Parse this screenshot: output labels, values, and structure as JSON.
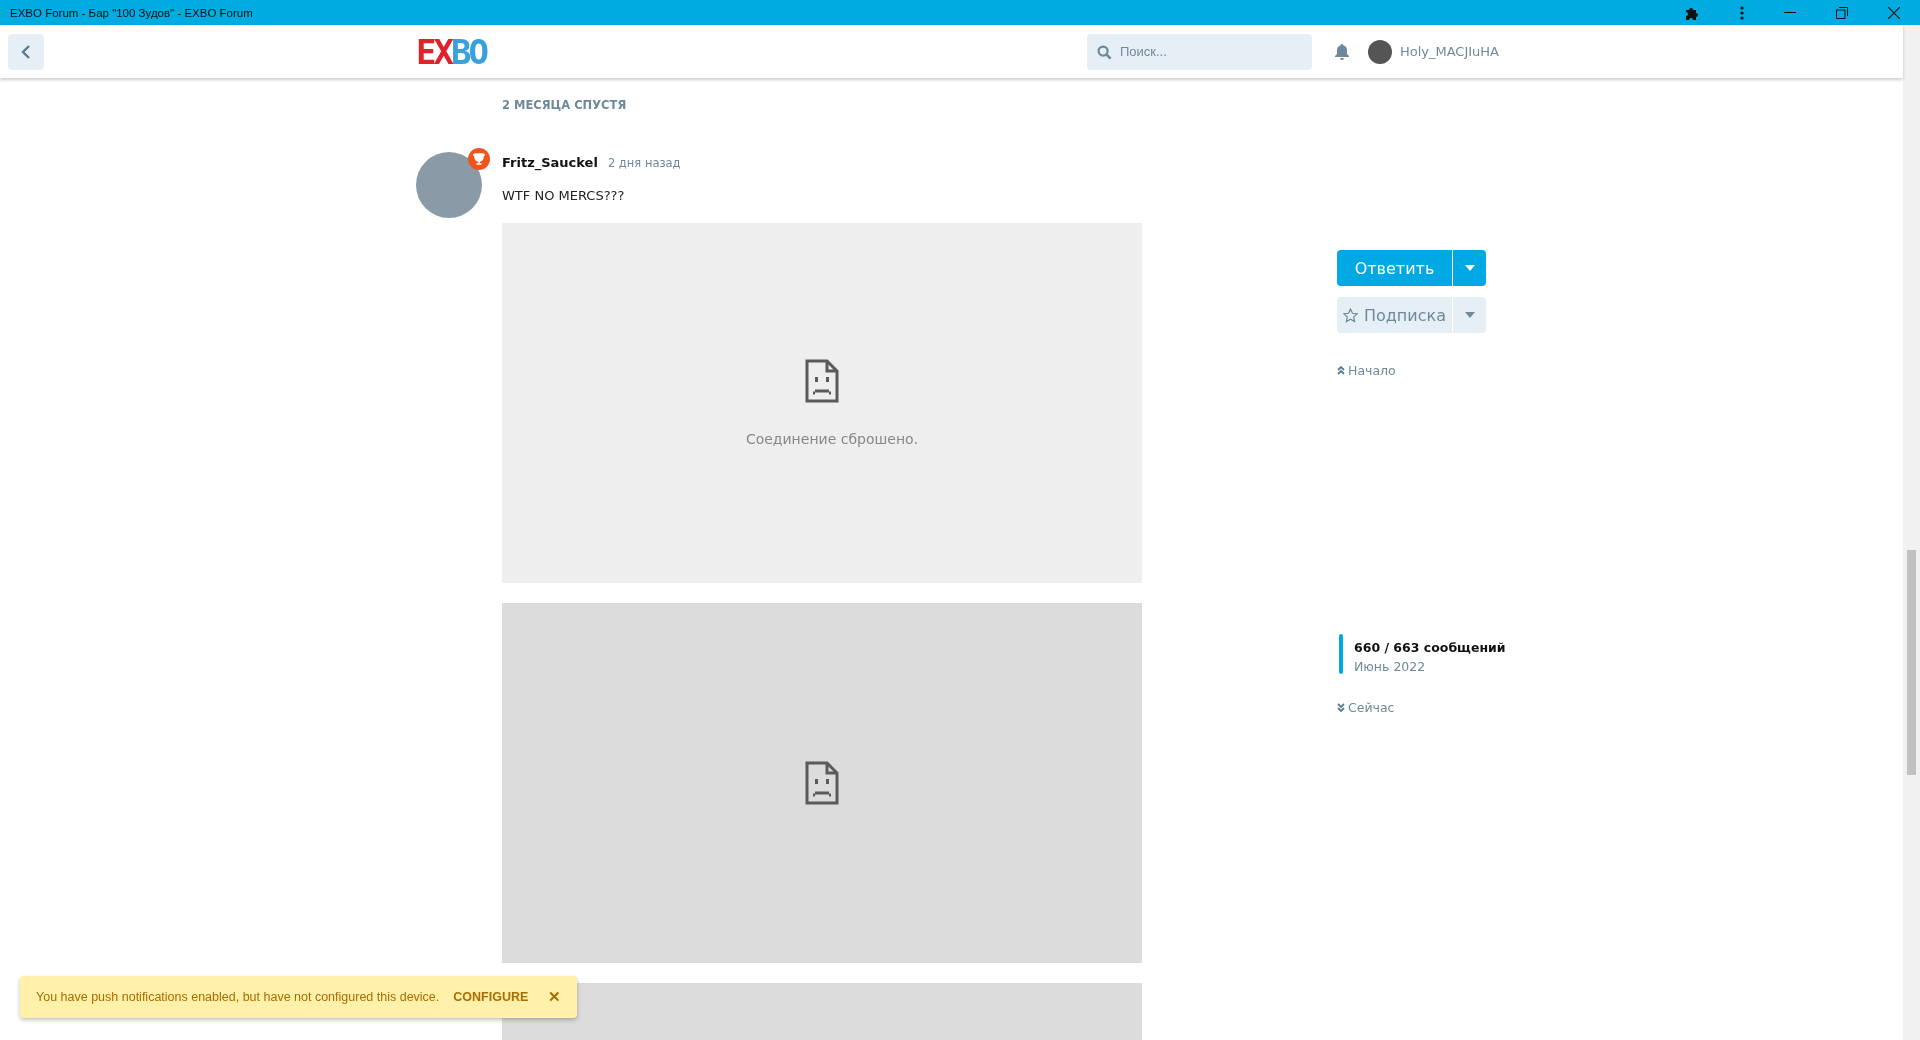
{
  "window": {
    "title": "EXBO Forum - Бар \"100 Зудов\" - EXBO Forum"
  },
  "header": {
    "logo": "EXBO",
    "search": {
      "placeholder": "Поиск..."
    },
    "username": "Holy_MACJIuHA"
  },
  "time_gap": "2 МЕСЯЦА СПУСТЯ",
  "post": {
    "author": "Fritz_Sauckel",
    "time": "2 дня назад",
    "body": "WTF NO MERCS???",
    "embeds": [
      {
        "kind": "error",
        "message": "Соединение сброшено.",
        "dark": false
      },
      {
        "kind": "error",
        "dark": true
      },
      {
        "kind": "blank",
        "dark": true
      }
    ]
  },
  "sidebar": {
    "reply_button": "Ответить",
    "subscribe_button": "Подписка",
    "start_link": "Начало",
    "scrubber": {
      "count": "660 / 663 сообщений",
      "date": "Июнь 2022",
      "level": 0.99
    },
    "now_link": "Сейчас"
  },
  "alert": {
    "message": "You have push notifications enabled, but have not configured this device.",
    "action": "CONFIGURE",
    "close": "✕"
  }
}
